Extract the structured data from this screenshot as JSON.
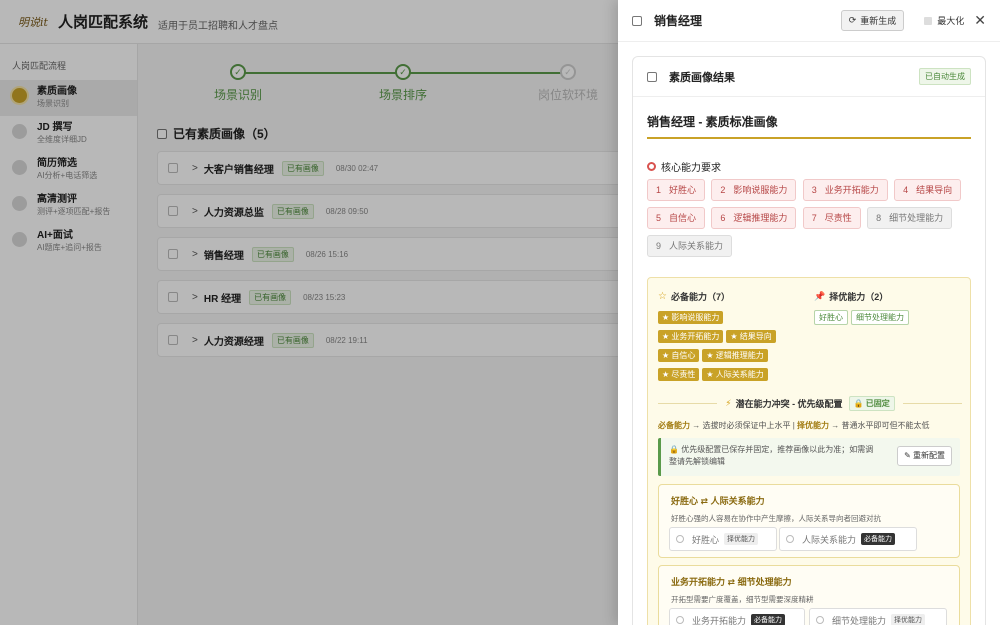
{
  "app": {
    "logo": "明说it",
    "title": "人岗匹配系统",
    "subtitle": "适用于员工招聘和人才盘点"
  },
  "sidebar": {
    "title": "人岗匹配流程",
    "items": [
      {
        "label": "素质画像",
        "sub": "场景识别",
        "active": true
      },
      {
        "label": "JD 撰写",
        "sub": "全维度详细JD",
        "active": false
      },
      {
        "label": "简历筛选",
        "sub": "AI分析+电话筛选",
        "active": false
      },
      {
        "label": "高清测评",
        "sub": "测评+逐项匹配+报告",
        "active": false
      },
      {
        "label": "AI+面试",
        "sub": "AI题库+追问+报告",
        "active": false
      }
    ]
  },
  "main": {
    "steps": [
      {
        "label": "场景识别",
        "done": true
      },
      {
        "label": "场景排序",
        "done": true
      },
      {
        "label": "岗位软环境",
        "done": false
      }
    ],
    "section_title": "已有素质画像（5）",
    "rows": [
      {
        "name": "大客户销售经理",
        "tag": "已有画像",
        "date": "08/30 02:47"
      },
      {
        "name": "人力资源总监",
        "tag": "已有画像",
        "date": "08/28 09:50"
      },
      {
        "name": "销售经理",
        "tag": "已有画像",
        "date": "08/26 15:16"
      },
      {
        "name": "HR 经理",
        "tag": "已有画像",
        "date": "08/23 15:23"
      },
      {
        "name": "人力资源经理",
        "tag": "已有画像",
        "date": "08/22 19:11"
      }
    ]
  },
  "drawer": {
    "title": "销售经理",
    "regen_label": "重新生成",
    "max_label": "最大化",
    "card_title": "素质画像结果",
    "auto_tag": "已自动生成",
    "portrait_title": "销售经理 - 素质标准画像",
    "core_title": "核心能力要求",
    "core_items": [
      {
        "num": "1",
        "label": "好胜心",
        "grey": false
      },
      {
        "num": "2",
        "label": "影响说服能力",
        "grey": false
      },
      {
        "num": "3",
        "label": "业务开拓能力",
        "grey": false
      },
      {
        "num": "4",
        "label": "结果导向",
        "grey": false
      },
      {
        "num": "5",
        "label": "自信心",
        "grey": false
      },
      {
        "num": "6",
        "label": "逻辑推理能力",
        "grey": false
      },
      {
        "num": "7",
        "label": "尽责性",
        "grey": false
      },
      {
        "num": "8",
        "label": "细节处理能力",
        "grey": true
      },
      {
        "num": "9",
        "label": "人际关系能力",
        "grey": true
      }
    ],
    "required_title": "必备能力（7）",
    "required": [
      "★ 影响说服能力",
      "★ 业务开拓能力",
      "★ 结果导向",
      "★ 自信心",
      "★ 逻辑推理能力",
      "★ 尽责性",
      "★ 人际关系能力"
    ],
    "preferred_title": "择优能力（2）",
    "preferred": [
      "好胜心",
      "细节处理能力"
    ],
    "conflict_title": "潜在能力冲突 - 优先级配置",
    "fixed_tag": "已固定",
    "rule_required": "必备能力",
    "rule_required_text": "→ 选拔时必须保证中上水平",
    "rule_sep": "|",
    "rule_preferred": "择优能力",
    "rule_preferred_text": "→ 普通水平即可但不能太低",
    "note": "优先级配置已保存并固定，推荐画像以此为准；如需调整请先解锁编辑",
    "reconfig_label": "重新配置",
    "pairs": [
      {
        "left": "好胜心",
        "arrow": "⇄",
        "right": "人际关系能力",
        "desc": "好胜心强的人容易在协作中产生摩擦，人际关系导向者回避对抗",
        "opt1": "好胜心",
        "opt1_badge": "择优能力",
        "opt2": "人际关系能力",
        "opt2_badge": "必备能力"
      },
      {
        "left": "业务开拓能力",
        "arrow": "⇄",
        "right": "细节处理能力",
        "desc": "开拓型需要广度覆盖，细节型需要深度精耕",
        "opt1": "业务开拓能力",
        "opt1_badge": "必备能力",
        "opt2": "细节处理能力",
        "opt2_badge": "择优能力"
      }
    ]
  }
}
